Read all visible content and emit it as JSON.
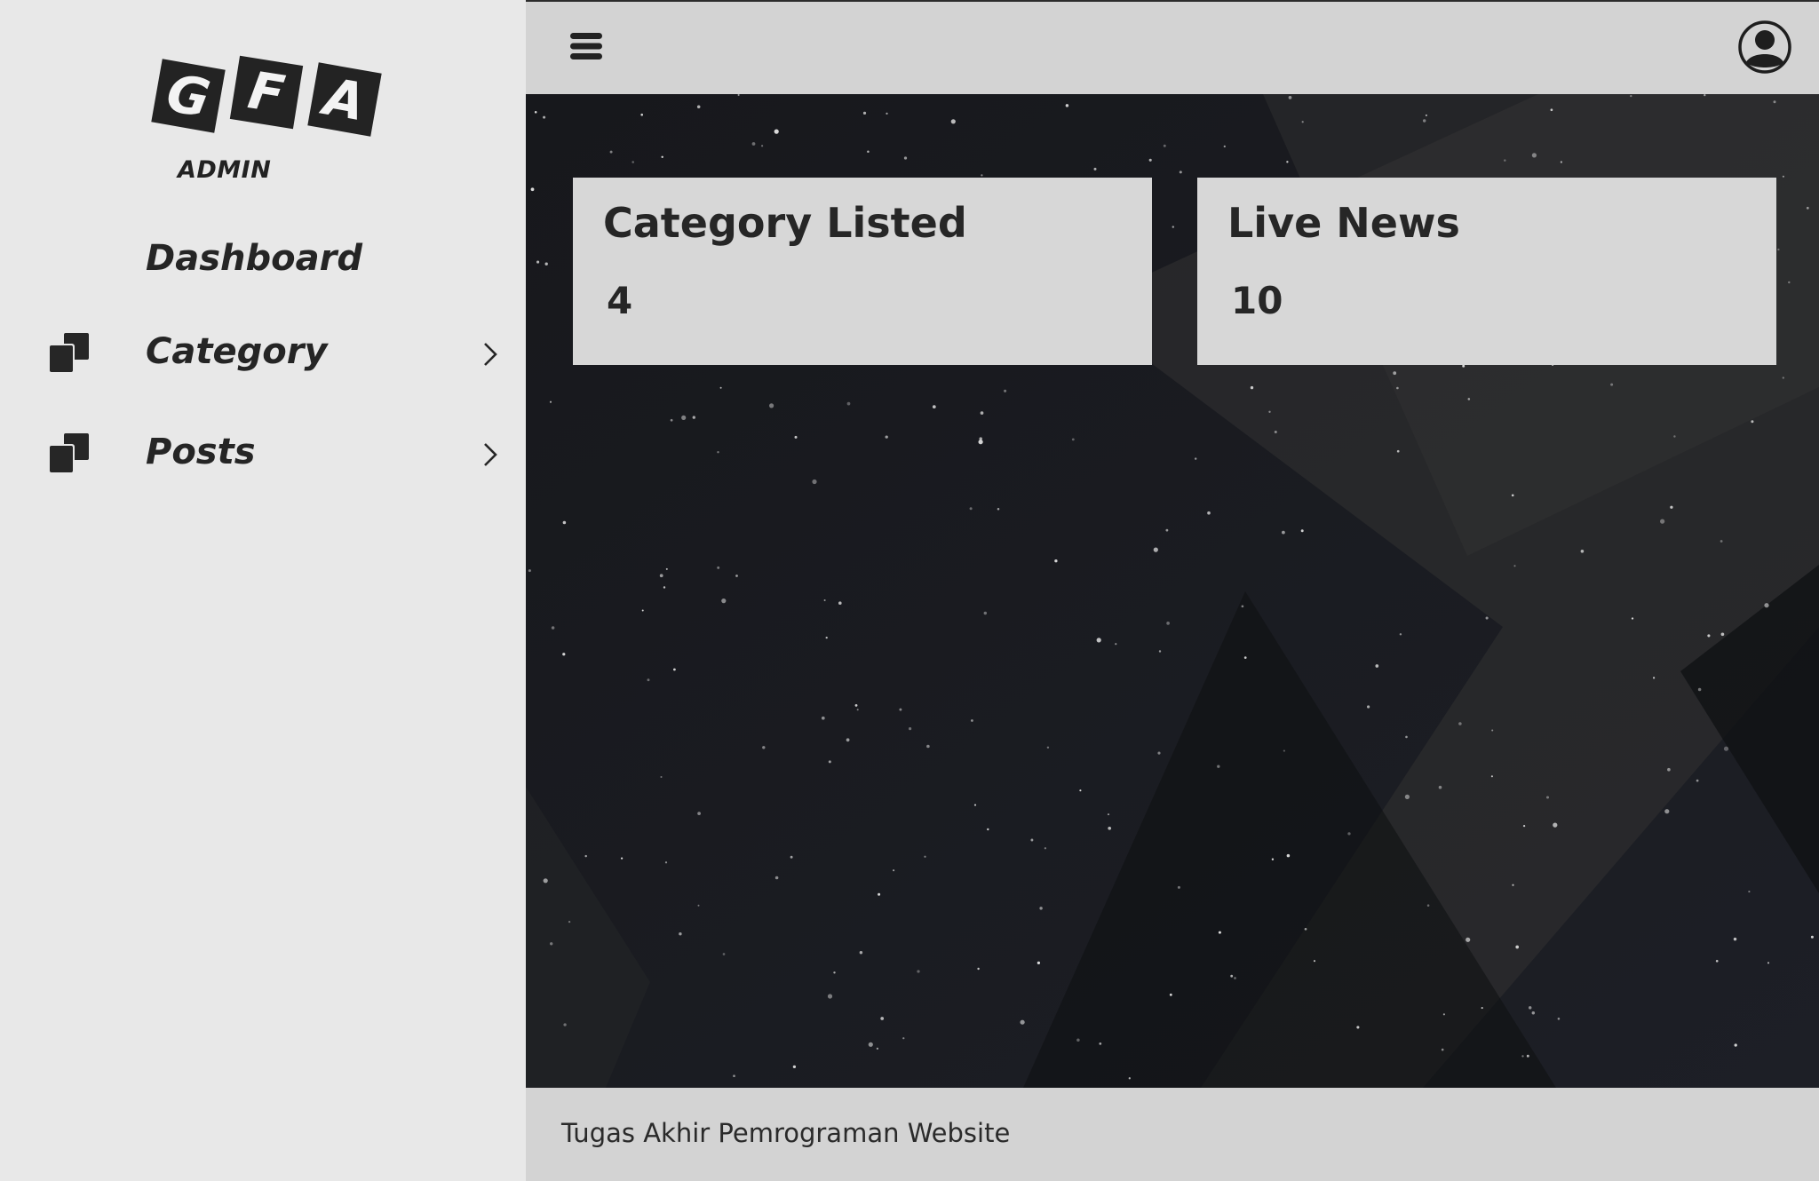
{
  "logo": {
    "letters": [
      "G",
      "F",
      "A"
    ],
    "subtitle": "ADMIN"
  },
  "sidebar": {
    "items": [
      {
        "label": "Dashboard",
        "icon": "none"
      },
      {
        "label": "Category",
        "icon": "stacked-squares-icon",
        "chevron": "chevron-right-icon"
      },
      {
        "label": "Posts",
        "icon": "stacked-squares-icon",
        "chevron": "chevron-right-icon"
      }
    ]
  },
  "topbar": {
    "menu_icon": "hamburger-menu-icon",
    "user_icon": "user-account-icon"
  },
  "cards": [
    {
      "title": "Category Listed",
      "value": "4"
    },
    {
      "title": "Live News",
      "value": "10"
    }
  ],
  "footer": {
    "text": "Tugas Akhir Pemrograman Website"
  },
  "colors": {
    "sidebar_bg": "#e8e8e8",
    "topbar_bg": "#d3d3d3",
    "card_bg": "#d7d7d7",
    "main_bg": "#141519",
    "text_dark": "#252525"
  }
}
